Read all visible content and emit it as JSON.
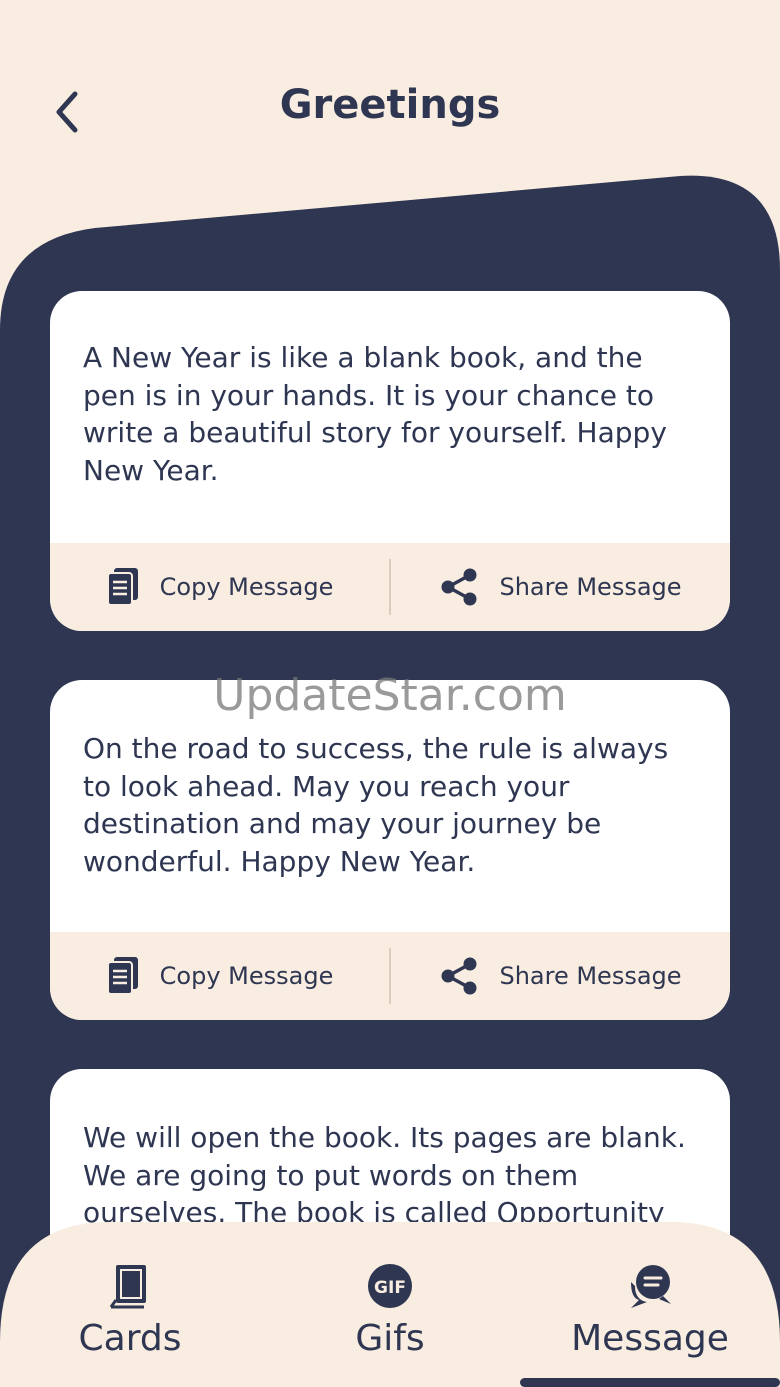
{
  "header": {
    "title": "Greetings",
    "back_icon": "chevron-left-icon"
  },
  "colors": {
    "background": "#f8ede0",
    "navy": "#2f3652",
    "card": "#ffffff"
  },
  "cards": [
    {
      "text": "A New Year is like a blank book, and the pen is in your hands. It is your chance to write a beautiful story for yourself. Happy New Year.",
      "copy_label": "Copy Message",
      "share_label": "Share Message"
    },
    {
      "text": "On the road to success, the rule is always to look ahead. May you reach your destination and may your journey be wonderful. Happy New Year.",
      "copy_label": "Copy Message",
      "share_label": "Share Message"
    },
    {
      "text": "We will open the book. Its pages are blank. We are going to put words on them ourselves. The book is called Opportunity"
    }
  ],
  "watermark": "UpdateStar.com",
  "nav": {
    "items": [
      {
        "label": "Cards",
        "icon": "card-icon"
      },
      {
        "label": "Gifs",
        "icon": "gif-icon"
      },
      {
        "label": "Message",
        "icon": "chat-bubble-icon"
      }
    ],
    "active": "Message"
  }
}
